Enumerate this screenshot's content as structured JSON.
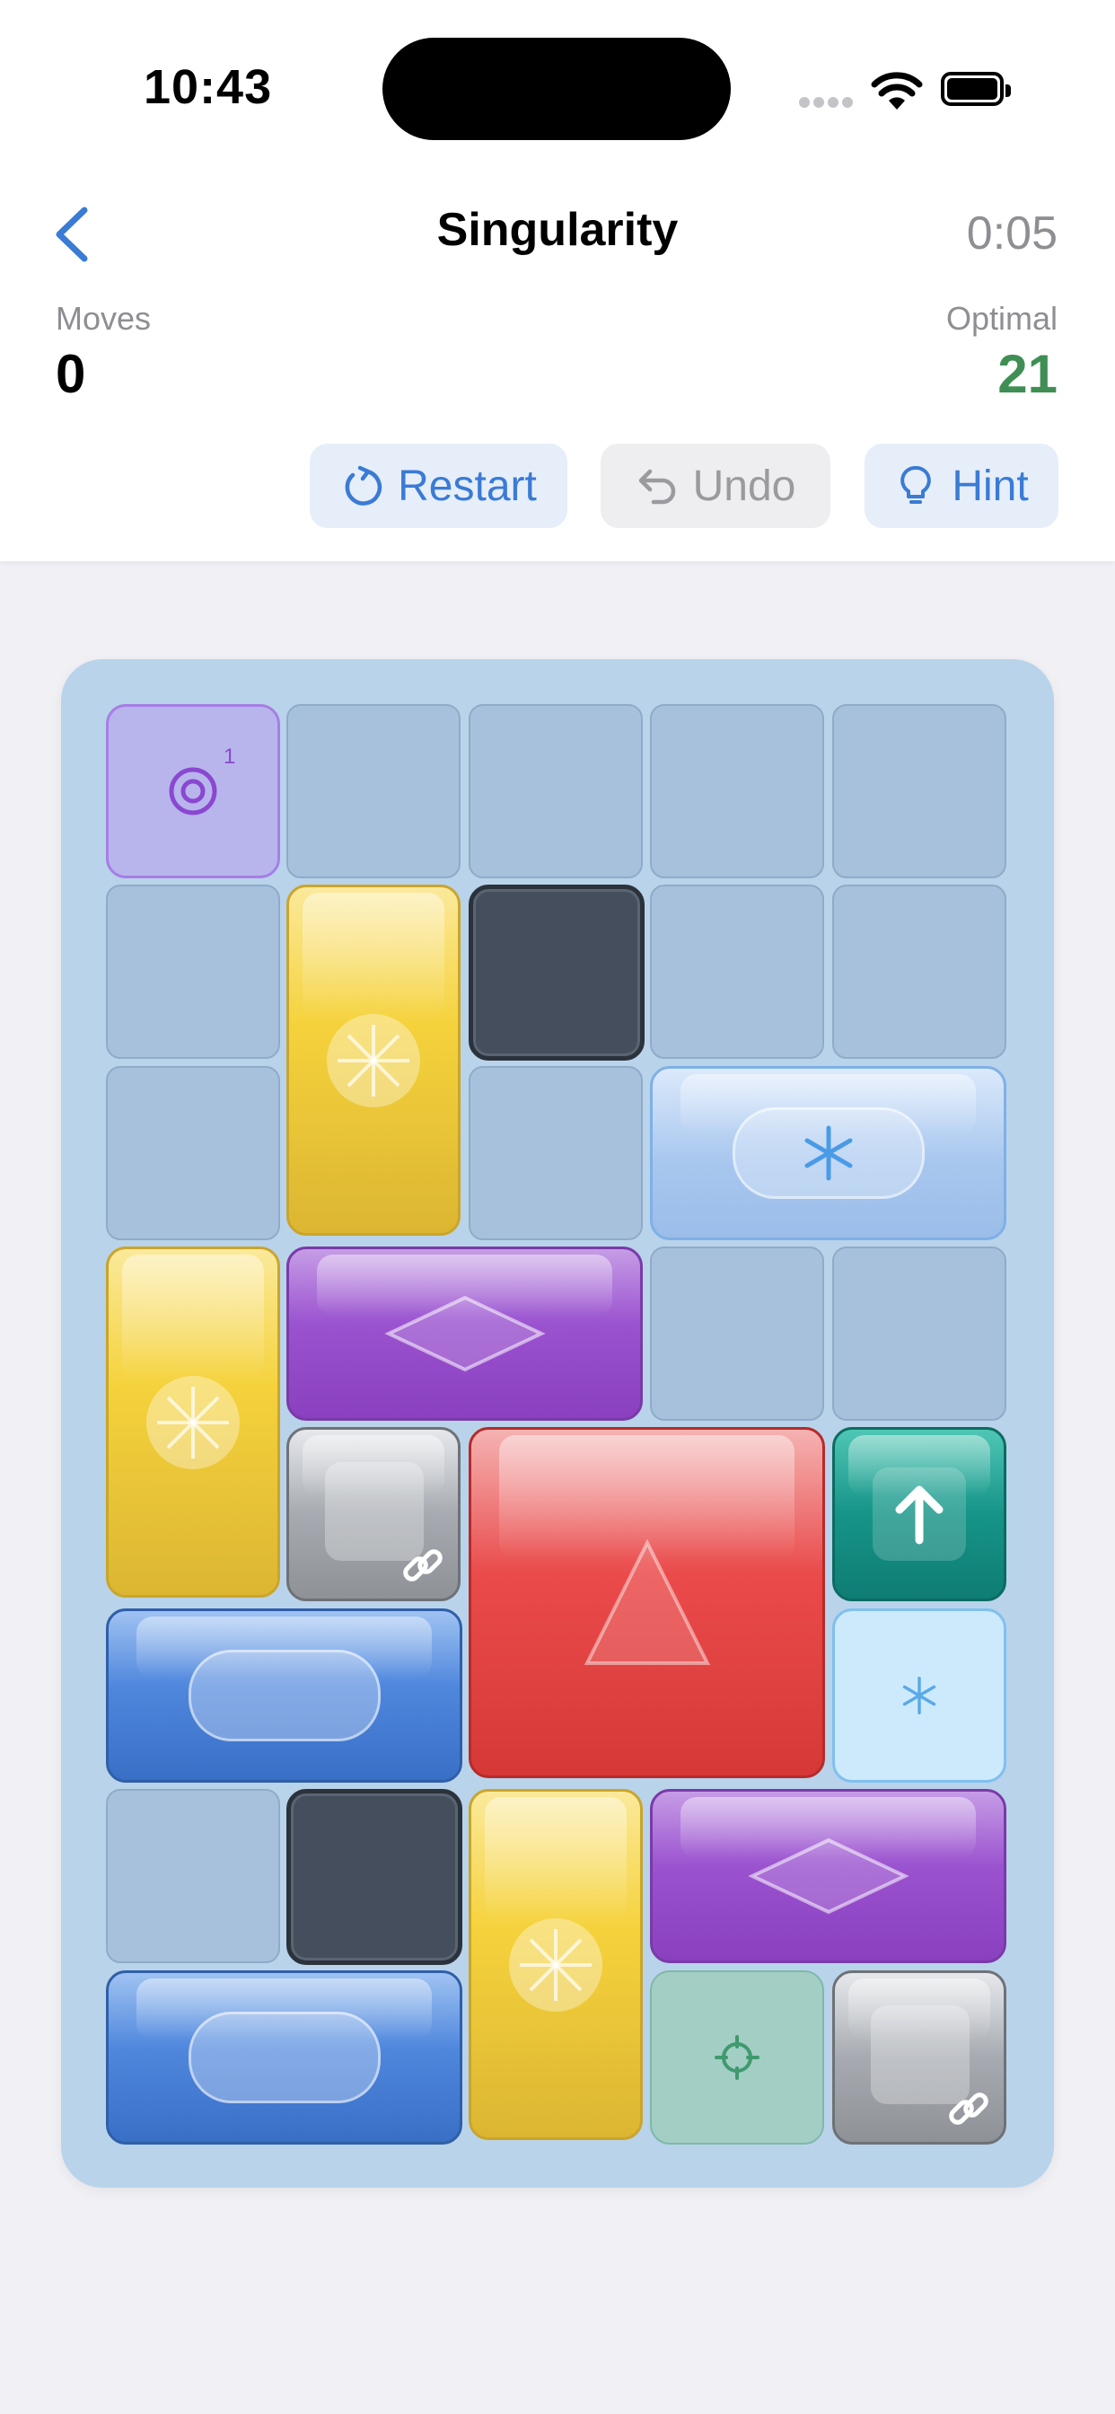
{
  "status_bar": {
    "time": "10:43"
  },
  "header": {
    "title": "Singularity",
    "timer": "0:05",
    "moves_label": "Moves",
    "moves_value": "0",
    "optimal_label": "Optimal",
    "optimal_value": "21"
  },
  "actions": {
    "restart": "Restart",
    "undo": "Undo",
    "hint": "Hint"
  },
  "board": {
    "portal_label": "1",
    "pieces": [
      {
        "name": "portal-target-tile",
        "type": "portal",
        "color": "#b8b5ec"
      },
      {
        "name": "yellow-vertical-block",
        "type": "yellow",
        "color": "#f5d23c"
      },
      {
        "name": "dark-wall-block",
        "type": "dark",
        "color": "#444e5c"
      },
      {
        "name": "ice-horizontal-block",
        "type": "lightblue",
        "color": "#a8c7ef"
      },
      {
        "name": "yellow-vertical-block",
        "type": "yellow",
        "color": "#f5d23c"
      },
      {
        "name": "purple-horizontal-block",
        "type": "purple",
        "color": "#9a52cf"
      },
      {
        "name": "gray-linked-block",
        "type": "gray",
        "color": "#a7abb1"
      },
      {
        "name": "red-main-block",
        "type": "red",
        "color": "#ea4a4a"
      },
      {
        "name": "teal-up-arrow-block",
        "type": "teal",
        "color": "#169488"
      },
      {
        "name": "blue-horizontal-block",
        "type": "blue",
        "color": "#4f87dd"
      },
      {
        "name": "ice-tile",
        "type": "ice",
        "color": "#cdeafc"
      },
      {
        "name": "dark-wall-block",
        "type": "dark",
        "color": "#444e5c"
      },
      {
        "name": "yellow-vertical-block",
        "type": "yellow",
        "color": "#f5d23c"
      },
      {
        "name": "purple-horizontal-block",
        "type": "purple",
        "color": "#9a52cf"
      },
      {
        "name": "blue-horizontal-block",
        "type": "blue",
        "color": "#4f87dd"
      },
      {
        "name": "target-tile",
        "type": "target",
        "color": "#a3cec4"
      },
      {
        "name": "gray-linked-block",
        "type": "gray",
        "color": "#a7abb1"
      }
    ]
  }
}
